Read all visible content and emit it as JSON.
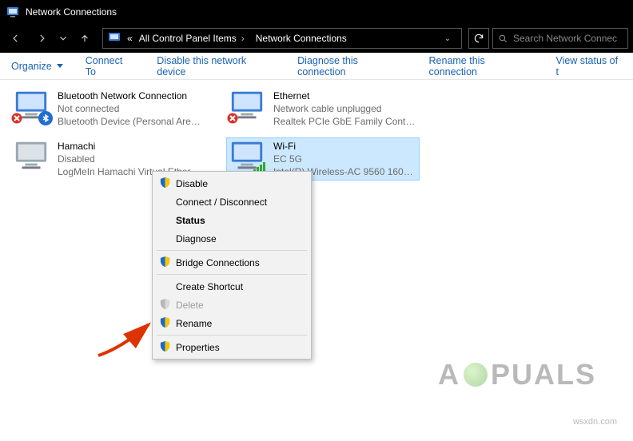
{
  "window": {
    "title": "Network Connections"
  },
  "nav": {
    "crumb1": "All Control Panel Items",
    "crumb2": "Network Connections",
    "crumb_prefix": "«",
    "search_placeholder": "Search Network Connec"
  },
  "commands": {
    "organize": "Organize",
    "connect_to": "Connect To",
    "disable": "Disable this network device",
    "diagnose": "Diagnose this connection",
    "rename": "Rename this connection",
    "viewstatus": "View status of t"
  },
  "adapters": [
    {
      "name": "Bluetooth Network Connection",
      "status": "Not connected",
      "device": "Bluetooth Device (Personal Area ..."
    },
    {
      "name": "Ethernet",
      "status": "Network cable unplugged",
      "device": "Realtek PCIe GbE Family Controller"
    },
    {
      "name": "Hamachi",
      "status": "Disabled",
      "device": "LogMeIn Hamachi Virtual Etherne..."
    },
    {
      "name": "Wi-Fi",
      "status": "EC 5G",
      "device": "Intel(R) Wireless-AC 9560 160MH..."
    }
  ],
  "context_menu": {
    "disable": "Disable",
    "connect": "Connect / Disconnect",
    "status": "Status",
    "diagnose": "Diagnose",
    "bridge": "Bridge Connections",
    "shortcut": "Create Shortcut",
    "delete": "Delete",
    "rename": "Rename",
    "properties": "Properties"
  },
  "watermark": {
    "brand_left": "A",
    "brand_right": "PUALS",
    "domain": "wsxdn.com"
  }
}
